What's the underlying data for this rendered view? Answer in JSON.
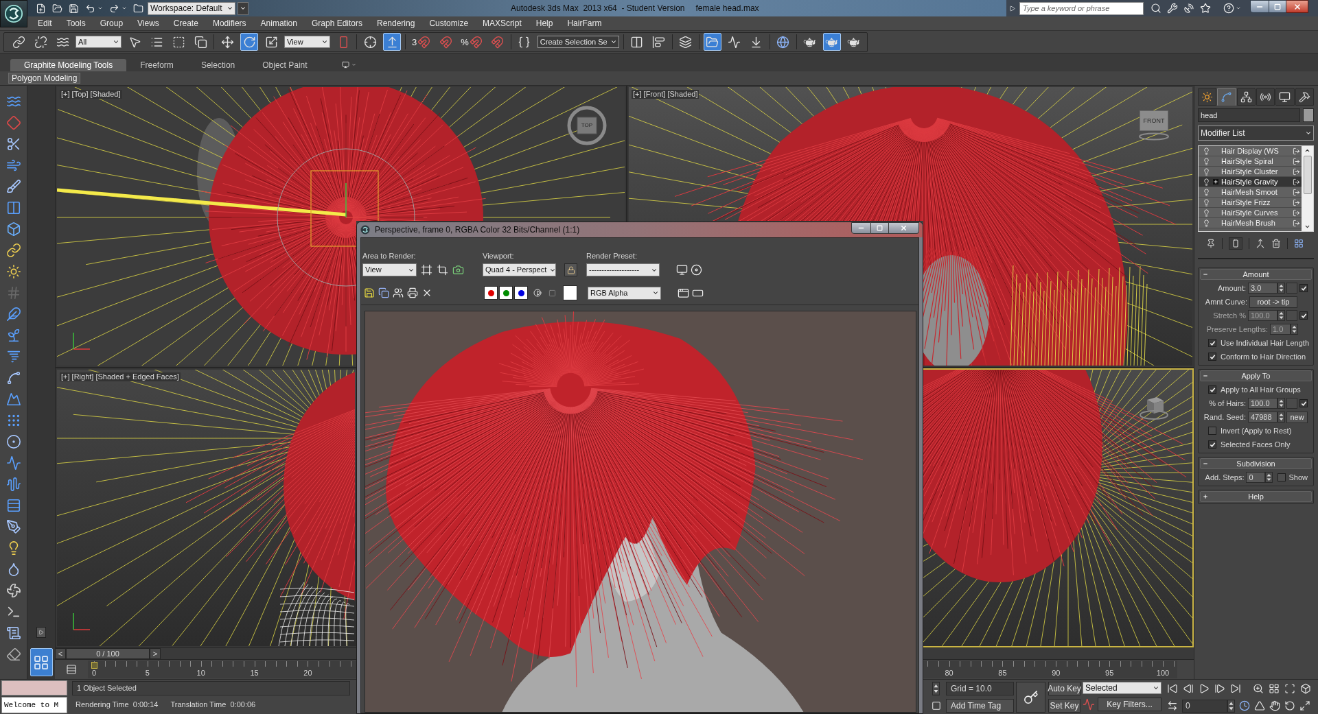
{
  "title_bar": {
    "workspace": "Workspace: Default",
    "app_title": "Autodesk 3ds Max  2013 x64  - Student Version",
    "file_name": "female head.max",
    "search": {
      "placeholder": "Type a keyword or phrase"
    }
  },
  "menu": [
    "Edit",
    "Tools",
    "Group",
    "Views",
    "Create",
    "Modifiers",
    "Animation",
    "Graph Editors",
    "Rendering",
    "Customize",
    "MAXScript",
    "Help",
    "HairFarm"
  ],
  "main_toolbar": [
    {
      "kind": "link",
      "selected": false
    },
    {
      "kind": "unlink",
      "selected": false
    },
    {
      "kind": "bind",
      "selected": false
    },
    {
      "kind": "dropdown",
      "value": "All"
    },
    {
      "kind": "select",
      "selected": false
    },
    {
      "kind": "namelist",
      "selected": false
    },
    {
      "kind": "region",
      "selected": false
    },
    {
      "kind": "crossing",
      "selected": false
    },
    {
      "kind": "move",
      "selected": false
    },
    {
      "kind": "rotate",
      "selected": true
    },
    {
      "kind": "scale",
      "selected": false
    },
    {
      "kind": "dropdown",
      "value": "View"
    },
    {
      "kind": "pivot",
      "selected": false
    },
    {
      "kind": "manipulate",
      "selected": false
    },
    {
      "kind": "shortcut",
      "selected": true
    },
    {
      "kind": "snap",
      "label": "3",
      "selected": false
    },
    {
      "kind": "anglesnap",
      "selected": false
    },
    {
      "kind": "percentsnap",
      "label": "%",
      "selected": false
    },
    {
      "kind": "spinnersnap",
      "selected": false
    },
    {
      "kind": "namedsets",
      "selected": false
    },
    {
      "kind": "combo",
      "value": "Create Selection Se"
    },
    {
      "kind": "mirror",
      "selected": false
    },
    {
      "kind": "align",
      "selected": false
    },
    {
      "kind": "layers",
      "selected": false
    },
    {
      "kind": "explorer",
      "selected": true
    },
    {
      "kind": "curves",
      "selected": false
    },
    {
      "kind": "schematic",
      "selected": false
    },
    {
      "kind": "material",
      "selected": false
    },
    {
      "kind": "setup",
      "selected": false
    },
    {
      "kind": "framewindow",
      "selected": true
    },
    {
      "kind": "render",
      "selected": false
    }
  ],
  "ribbon": {
    "tabs": [
      {
        "label": "Graphite Modeling Tools",
        "selected": true
      },
      {
        "label": "Freeform",
        "selected": false
      },
      {
        "label": "Selection",
        "selected": false
      },
      {
        "label": "Object Paint",
        "selected": false
      }
    ],
    "panel": "Polygon Modeling"
  },
  "viewports": [
    {
      "kind": "top",
      "label": "[+] [Top] [Shaded]",
      "active": false,
      "viewcube": "TOP"
    },
    {
      "kind": "front",
      "label": "[+] [Front] [Shaded]",
      "active": false,
      "viewcube": "FRONT"
    },
    {
      "kind": "right",
      "label": "[+] [Right] [Shaded + Edged Faces]",
      "active": false
    },
    {
      "kind": "perspective",
      "active": true
    }
  ],
  "time_slider": {
    "prev": "<",
    "position": "0 / 100",
    "next": ">"
  },
  "track_bar": {
    "left_labels": [
      "0",
      "5",
      "10",
      "15",
      "20"
    ],
    "right_labels": [
      "80",
      "85",
      "90",
      "95",
      "100"
    ]
  },
  "command_panel": {
    "tabs": [
      {
        "kind": "create",
        "selected": false
      },
      {
        "kind": "modify",
        "selected": true
      },
      {
        "kind": "hierarchy",
        "selected": false
      },
      {
        "kind": "motion",
        "selected": false
      },
      {
        "kind": "display",
        "selected": false
      },
      {
        "kind": "utilities",
        "selected": false
      }
    ],
    "object_name": "head",
    "modifier_list": "Modifier List",
    "stack": [
      {
        "label": "Hair Display (WS",
        "selected": false,
        "expandable": false
      },
      {
        "label": "HairStyle Spiral",
        "selected": false,
        "expandable": false
      },
      {
        "label": "HairStyle Cluster",
        "selected": false,
        "expandable": false
      },
      {
        "label": "HairStyle Gravity",
        "selected": true,
        "expandable": true
      },
      {
        "label": "HairMesh Smoot",
        "selected": false,
        "expandable": false
      },
      {
        "label": "HairStyle Frizz",
        "selected": false,
        "expandable": false
      },
      {
        "label": "HairStyle Curves",
        "selected": false,
        "expandable": false
      },
      {
        "label": "HairMesh Brush",
        "selected": false,
        "expandable": false
      }
    ],
    "rollouts": [
      {
        "title": "Amount",
        "expanded": true,
        "rows": [
          {
            "kind": "spinner",
            "label": "Amount:",
            "value": "3.0",
            "checked": true,
            "disabled": false
          },
          {
            "kind": "curve",
            "label": "Amnt Curve:",
            "value": "root -> tip"
          },
          {
            "kind": "spinner",
            "label": "Stretch %",
            "value": "100.0",
            "checked": true,
            "disabled": true
          },
          {
            "kind": "spinner",
            "label": "Preserve Lengths:",
            "value": "1.0",
            "disabled": true
          },
          {
            "kind": "checkbox",
            "label": "Use Individual Hair Length",
            "checked": true
          },
          {
            "kind": "checkbox",
            "label": "Conform to Hair Direction",
            "checked": true
          }
        ]
      },
      {
        "title": "Apply To",
        "expanded": true,
        "rows": [
          {
            "kind": "checkbox",
            "label": "Apply to All Hair Groups",
            "checked": true
          },
          {
            "kind": "spinner",
            "label": "% of Hairs:",
            "value": "100.0",
            "checked": true,
            "disabled": false
          },
          {
            "kind": "seed",
            "label": "Rand. Seed:",
            "value": "47988",
            "button": "new"
          },
          {
            "kind": "checkbox",
            "label": "Invert (Apply to Rest)",
            "checked": false
          },
          {
            "kind": "checkbox",
            "label": "Selected Faces Only",
            "checked": true
          }
        ]
      },
      {
        "title": "Subdivision",
        "expanded": true,
        "rows": [
          {
            "kind": "steps",
            "label": "Add. Steps:",
            "value": "0",
            "option": {
              "label": "Show",
              "checked": false
            }
          }
        ]
      },
      {
        "title": "Help",
        "expanded": false
      }
    ]
  },
  "status_bar": {
    "listener_output": "Welcome to M",
    "selection": "1 Object Selected",
    "render_time": "Rendering Time  0:00:14",
    "translation_time": "Translation Time  0:00:06",
    "grid": "Grid = 10.0",
    "time_tag": "Add Time Tag",
    "auto_key": "Auto Key",
    "set_key": "Set Key",
    "key_set": "Selected",
    "key_filters": "Key Filters...",
    "frame": "0"
  },
  "render_window": {
    "title": "Perspective, frame 0, RGBA Color 32 Bits/Channel (1:1)",
    "area_label": "Area to Render:",
    "area": "View",
    "viewport_label": "Viewport:",
    "viewport": "Quad 4 - Perspect",
    "preset_label": "Render Preset:",
    "preset": "--------------------",
    "channels": [
      {
        "color": "#e00000",
        "on": true
      },
      {
        "color": "#008c00",
        "on": true
      },
      {
        "color": "#0000e0",
        "on": true
      }
    ],
    "display_channel": "RGB Alpha"
  }
}
